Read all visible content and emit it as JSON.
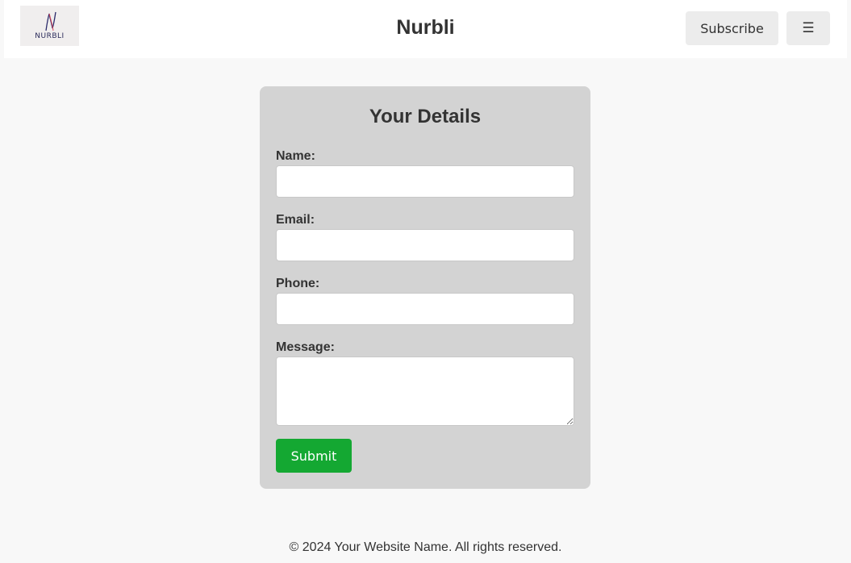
{
  "header": {
    "logo_text": "NURBLI",
    "title": "Nurbli",
    "subscribe_label": "Subscribe",
    "menu_icon": "☰"
  },
  "form": {
    "title": "Your Details",
    "fields": [
      {
        "label": "Name:",
        "value": "",
        "placeholder": ""
      },
      {
        "label": "Email:",
        "value": "",
        "placeholder": ""
      },
      {
        "label": "Phone:",
        "value": "",
        "placeholder": ""
      },
      {
        "label": "Message:",
        "value": "",
        "placeholder": ""
      }
    ],
    "submit_label": "Submit"
  },
  "footer": {
    "text": "© 2024 Your Website Name. All rights reserved."
  },
  "colors": {
    "page_background": "#f8f8f8",
    "header_background": "#ffffff",
    "card_background": "#d3d3d3",
    "button_background": "#ececec",
    "submit_background": "#14a832",
    "text": "#333333"
  },
  "icons": {
    "menu": "hamburger-menu-icon",
    "logo": "nurbli-logo"
  }
}
